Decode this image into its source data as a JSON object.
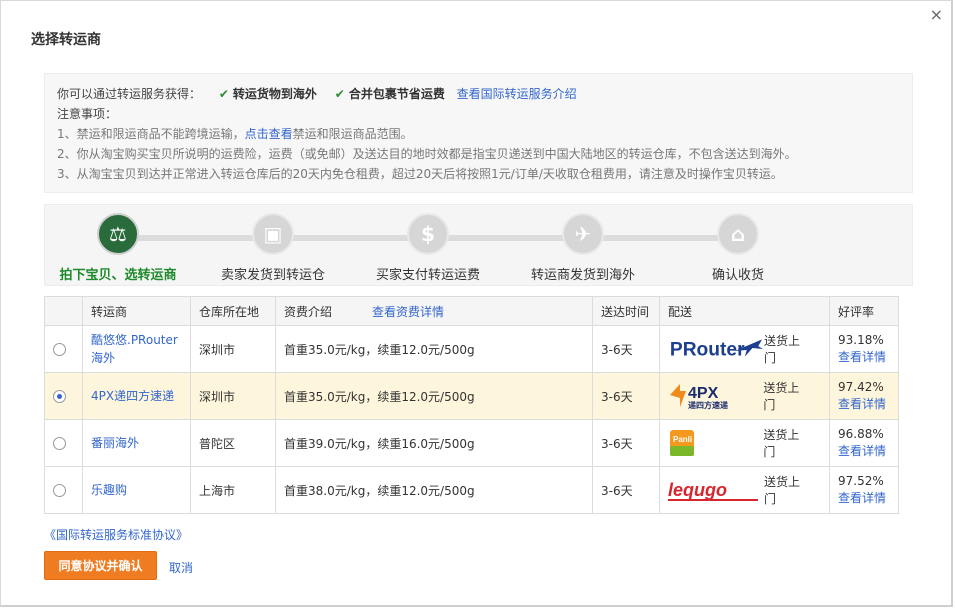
{
  "dialog": {
    "title": "选择转运商",
    "close_label": "×"
  },
  "notice": {
    "intro": "你可以通过转运服务获得：",
    "feature1": "转运货物到海外",
    "feature2": "合并包裹节省运费",
    "intro_link": "查看国际转运服务介绍",
    "heading": "注意事项：",
    "item1_pre": "1、禁运和限运商品不能跨境运输，",
    "item1_link": "点击查看",
    "item1_post": "禁运和限运商品范围。",
    "item2": "2、你从淘宝购买宝贝所说明的运费险，运费（或免邮）及送达目的地时效都是指宝贝递送到中国大陆地区的转运仓库，不包含送达到海外。",
    "item3": "3、从淘宝宝贝到达并正常进入转运仓库后的20天内免仓租费，超过20天后将按照1元/订单/天收取仓租费用，请注意及时操作宝贝转运。"
  },
  "steps": [
    {
      "label": "拍下宝贝、选转运商",
      "icon": "gavel-icon",
      "glyph": "⚖"
    },
    {
      "label": "卖家发货到转运仓",
      "icon": "truck-icon",
      "glyph": "▣"
    },
    {
      "label": "买家支付转运运费",
      "icon": "dollar-icon",
      "glyph": "$"
    },
    {
      "label": "转运商发货到海外",
      "icon": "airplane-icon",
      "glyph": "✈"
    },
    {
      "label": "确认收货",
      "icon": "house-icon",
      "glyph": "⌂"
    }
  ],
  "table": {
    "headers": {
      "carrier": "转运商",
      "warehouse": "仓库所在地",
      "fee": "资费介绍",
      "fee_link": "查看资费详情",
      "time": "送达时间",
      "delivery": "配送",
      "rating": "好评率"
    },
    "rows": [
      {
        "name_line1": "酷悠悠.PRouter",
        "name_line2": "海外",
        "city": "深圳市",
        "fee": "首重35.0元/kg，续重12.0元/500g",
        "time": "3-6天",
        "logo": "PRouter",
        "delivery": "送货上门",
        "rating": "93.18%",
        "rating_link": "查看详情",
        "selected": false
      },
      {
        "name_line1": "4PX递四方速递",
        "name_line2": "",
        "city": "深圳市",
        "fee": "首重35.0元/kg，续重12.0元/500g",
        "time": "3-6天",
        "logo": "4PX",
        "logo_sub": "递四方速递",
        "delivery": "送货上门",
        "rating": "97.42%",
        "rating_link": "查看详情",
        "selected": true
      },
      {
        "name_line1": "番丽海外",
        "name_line2": "",
        "city": "普陀区",
        "fee": "首重39.0元/kg，续重16.0元/500g",
        "time": "3-6天",
        "logo": "Panli",
        "delivery": "送货上门",
        "rating": "96.88%",
        "rating_link": "查看详情",
        "selected": false
      },
      {
        "name_line1": "乐趣购",
        "name_line2": "",
        "city": "上海市",
        "fee": "首重38.0元/kg，续重12.0元/500g",
        "time": "3-6天",
        "logo": "lequgo",
        "delivery": "送货上门",
        "rating": "97.52%",
        "rating_link": "查看详情",
        "selected": false
      }
    ]
  },
  "footer": {
    "agreement": "《国际转运服务标准协议》",
    "confirm": "同意协议并确认",
    "cancel": "取消"
  },
  "colors": {
    "accent_orange": "#f07c22",
    "link_blue": "#3366cc",
    "active_green": "#1f8a2b",
    "selected_row": "#fdf6dc"
  }
}
